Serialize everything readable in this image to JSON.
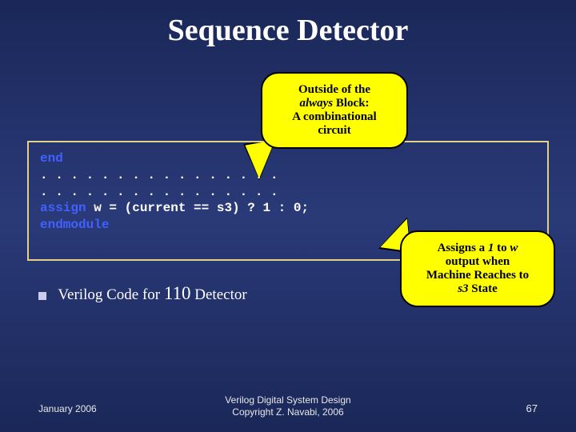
{
  "title": "Sequence Detector",
  "callout1": {
    "line1": "Outside of the",
    "line2_pre": "",
    "line2_em": "always",
    "line2_post": " Block:",
    "line3": "A combinational",
    "line4": "circuit"
  },
  "code": {
    "kw_end": "end",
    "dots1": ". . . . . . . . . . . . . . . .",
    "dots2": ". . . . . . . . . . . . . . . .",
    "kw_assign": "assign",
    "assign_rest": " w = (current == s3) ? 1 : 0;",
    "blank": "",
    "kw_endmodule": "endmodule"
  },
  "callout2": {
    "line1_pre": "Assigns a ",
    "line1_em1": "1",
    "line1_mid": " to ",
    "line1_em2": "w",
    "line2": "output when",
    "line3": "Machine Reaches to",
    "line4_em": "s3",
    "line4_post": " State"
  },
  "bullet": {
    "pre": "Verilog Code for ",
    "big": "110",
    "post": " Detector"
  },
  "footer": {
    "left": "January 2006",
    "center1": "Verilog Digital System Design",
    "center2": "Copyright Z. Navabi, 2006",
    "right": "67"
  }
}
